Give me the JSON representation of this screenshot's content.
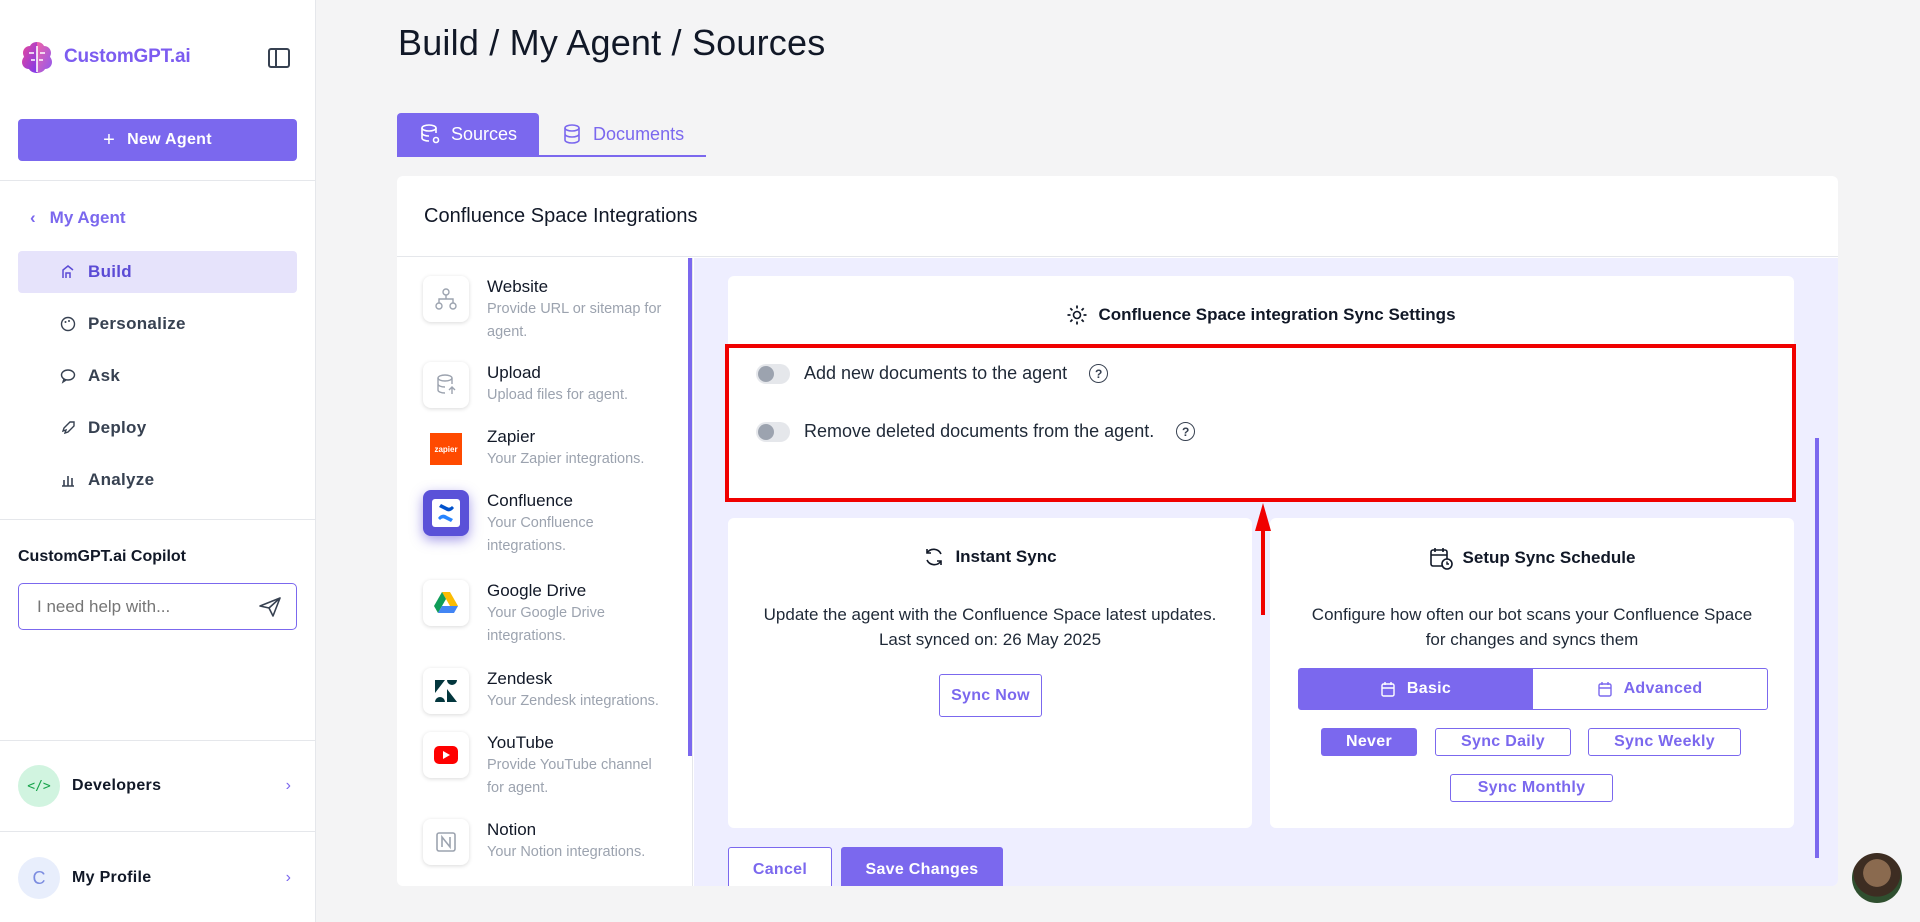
{
  "app": {
    "name": "CustomGPT.ai"
  },
  "sidebar": {
    "new_agent_label": "New Agent",
    "back_label": "My Agent",
    "nav": [
      {
        "label": "Build",
        "icon": "build-icon",
        "active": true
      },
      {
        "label": "Personalize",
        "icon": "palette-icon"
      },
      {
        "label": "Ask",
        "icon": "chat-icon"
      },
      {
        "label": "Deploy",
        "icon": "rocket-icon"
      },
      {
        "label": "Analyze",
        "icon": "bar-chart-icon"
      }
    ],
    "copilot": {
      "title": "CustomGPT.ai Copilot",
      "placeholder": "I need help with..."
    },
    "developers_label": "Developers",
    "profile": {
      "label": "My Profile",
      "initial": "C"
    }
  },
  "main": {
    "breadcrumb": "Build / My Agent / Sources",
    "tabs": [
      {
        "label": "Sources",
        "active": true
      },
      {
        "label": "Documents"
      }
    ],
    "card_title": "Confluence Space Integrations",
    "sources": [
      {
        "name": "Website",
        "desc": "Provide URL or sitemap for agent."
      },
      {
        "name": "Upload",
        "desc": "Upload files for agent."
      },
      {
        "name": "Zapier",
        "desc": "Your Zapier integrations."
      },
      {
        "name": "Confluence",
        "desc": "Your Confluence integrations.",
        "selected": true
      },
      {
        "name": "Google Drive",
        "desc": "Your Google Drive integrations."
      },
      {
        "name": "Zendesk",
        "desc": "Your Zendesk integrations."
      },
      {
        "name": "YouTube",
        "desc": "Provide YouTube channel for agent."
      },
      {
        "name": "Notion",
        "desc": "Your Notion integrations."
      }
    ],
    "sync_settings": {
      "title": "Confluence Space integration Sync Settings",
      "toggles": [
        {
          "label": "Add new documents to the agent",
          "on": false
        },
        {
          "label": "Remove deleted documents from the agent.",
          "on": false
        }
      ]
    },
    "instant_sync": {
      "title": "Instant Sync",
      "line1": "Update the agent with the Confluence Space latest updates.",
      "line2": "Last synced on: 26 May 2025",
      "button": "Sync Now"
    },
    "schedule": {
      "title": "Setup Sync Schedule",
      "line1": "Configure how often our bot scans your Confluence Space",
      "line2": "for changes and syncs them",
      "modes": [
        "Basic",
        "Advanced"
      ],
      "options": [
        "Never",
        "Sync Daily",
        "Sync Weekly",
        "Sync Monthly"
      ],
      "selected": "Never"
    },
    "cancel_label": "Cancel",
    "save_label": "Save Changes"
  },
  "colors": {
    "accent": "#7b68ee",
    "highlight": "#f00000"
  }
}
